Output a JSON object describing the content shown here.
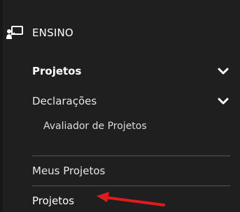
{
  "sidebar": {
    "section": {
      "icon": "presentation-board-icon",
      "label": "ENSINO"
    },
    "items": [
      {
        "label": "Projetos",
        "icon": "chevron-down-icon",
        "bold": true
      },
      {
        "label": "Declarações",
        "icon": "chevron-down-icon",
        "children": [
          {
            "label": "Avaliador de Projetos"
          }
        ]
      },
      {
        "label": "Meus Projetos"
      },
      {
        "label": "Projetos"
      }
    ]
  },
  "annotation": {
    "type": "red-arrow-icon",
    "color": "#e11b1b"
  },
  "colors": {
    "background": "#1f1f1f",
    "text": "#ffffff",
    "divider": "#555555"
  }
}
